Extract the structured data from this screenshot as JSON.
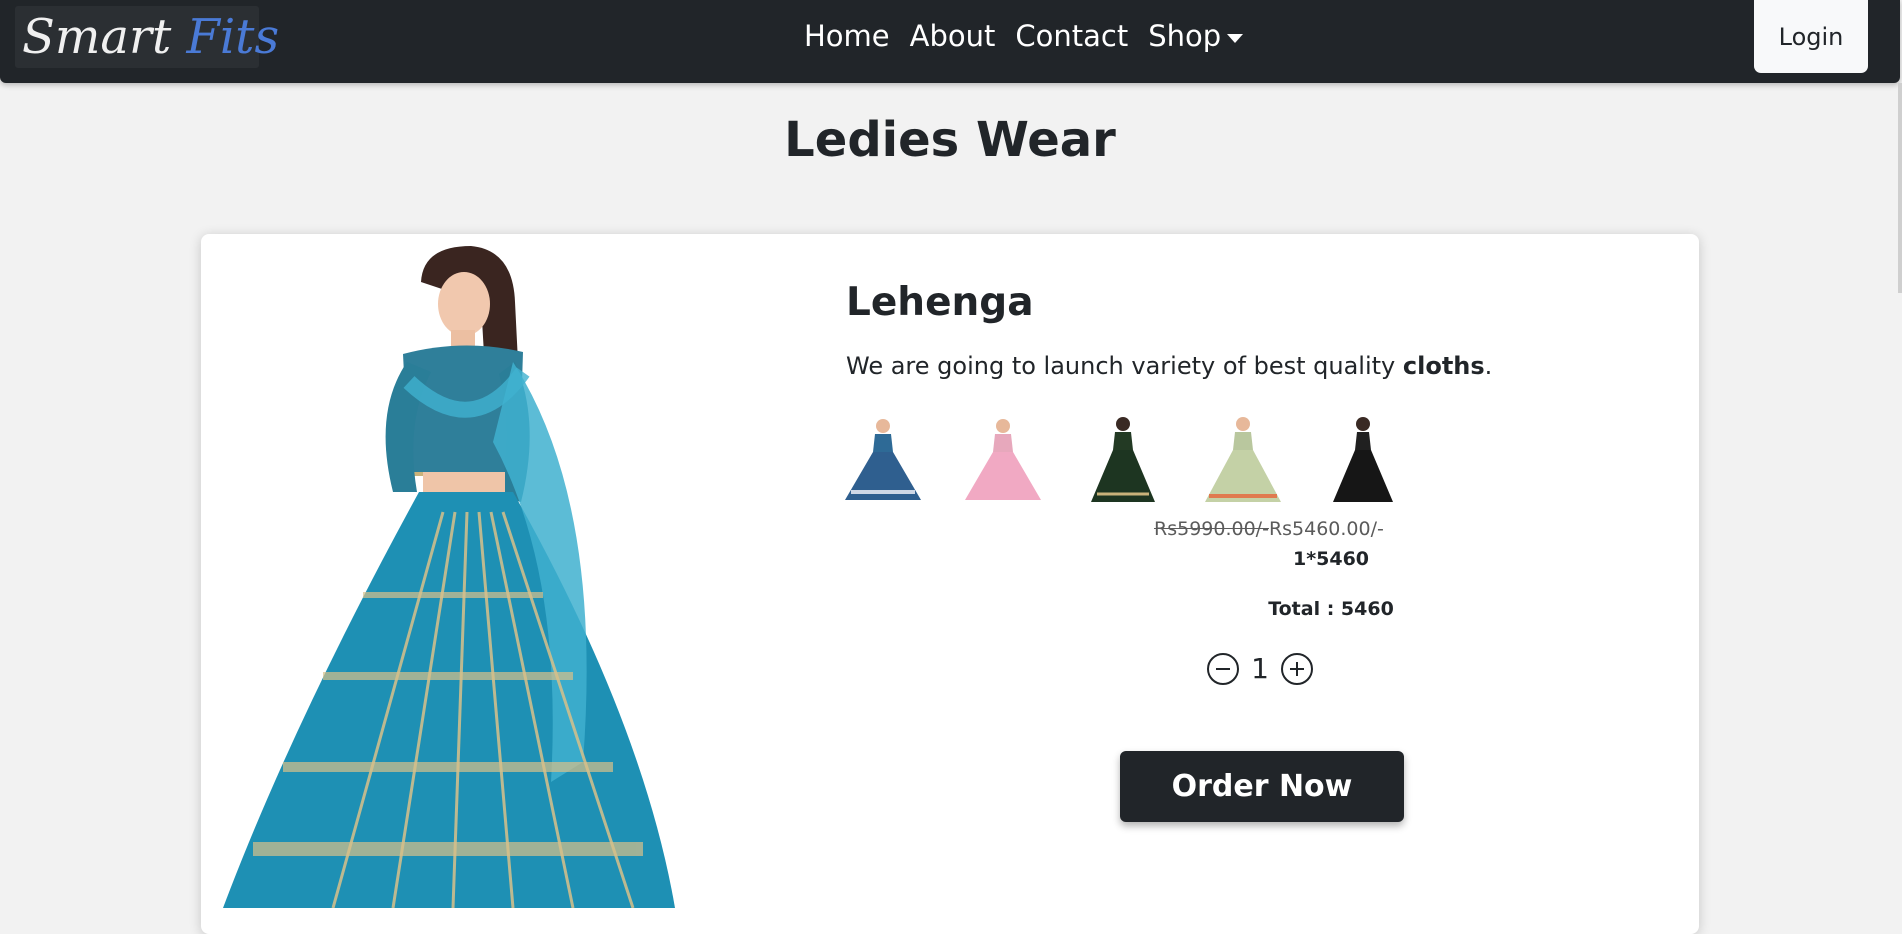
{
  "navbar": {
    "brand_part1": "Smart",
    "brand_part2": "Fits",
    "links": [
      "Home",
      "About",
      "Contact",
      "Shop"
    ],
    "login_label": "Login"
  },
  "page": {
    "title": "Ledies Wear"
  },
  "product": {
    "title": "Lehenga",
    "desc_prefix": "We are going to launch variety of best quality ",
    "desc_bold": "cloths",
    "desc_suffix": ".",
    "old_price": "Rs5990.00/-",
    "new_price": "Rs5460.00/-",
    "calc": "1*5460",
    "total": "Total : 5460",
    "quantity": "1",
    "order_label": "Order Now"
  },
  "colors": {
    "navbar_bg": "#212529",
    "brand_accent": "#4a7ad6",
    "page_bg": "#f2f2f2",
    "lehenga_teal": "#1e90b4"
  },
  "icons": {
    "minus": "minus-circle-icon",
    "plus": "plus-circle-icon",
    "dropdown": "caret-down-icon"
  }
}
